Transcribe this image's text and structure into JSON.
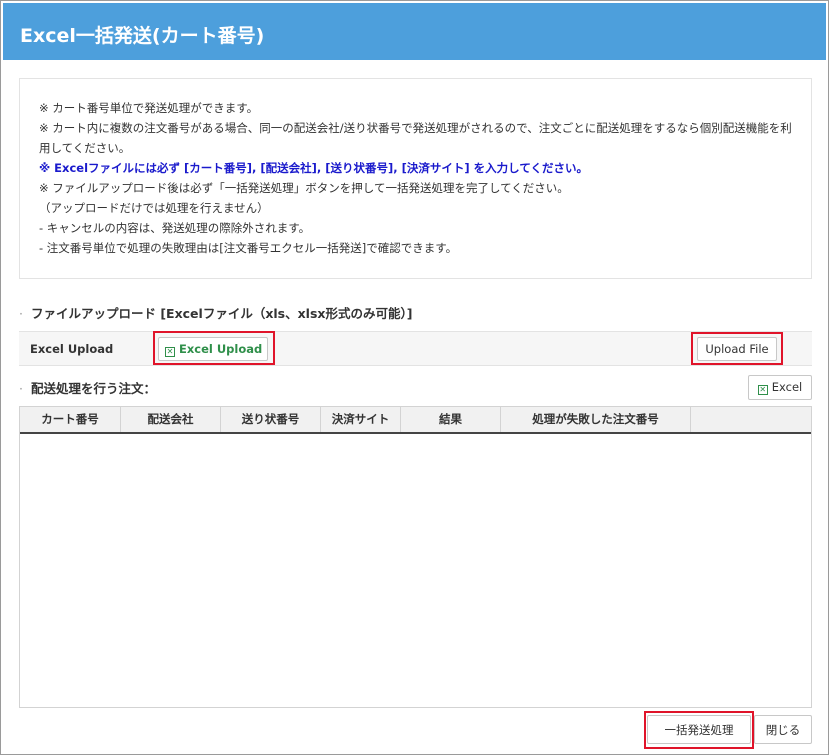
{
  "dialog": {
    "title": "Excel一括発送(カート番号)"
  },
  "notice": {
    "line1": "※ カート番号単位で発送処理ができます。",
    "line2": "※ カート内に複数の注文番号がある場合、同一の配送会社/送り状番号で発送処理がされるので、注文ごとに配送処理をするなら個別配送機能を利用してください。",
    "line3": "※ Excelファイルには必ず [カート番号], [配送会社], [送り状番号], [決済サイト] を入力してください。",
    "line4": "※ ファイルアップロード後は必ず「一括発送処理」ボタンを押して一括発送処理を完了してください。",
    "line5": "（アップロードだけでは処理を行えません）",
    "line6": "- キャンセルの内容は、発送処理の際除外されます。",
    "line7": "- 注文番号単位で処理の失敗理由は[注文番号エクセル一括発送]で確認できます。"
  },
  "upload": {
    "section_title": "ファイルアップロード [Excelファイル（xls、xlsx形式のみ可能）]",
    "row_label": "Excel Upload",
    "excel_button": "Excel Upload",
    "upload_button": "Upload File"
  },
  "results": {
    "section_title": "配送処理を行う注文：",
    "excel_button": "Excel",
    "columns": [
      "カート番号",
      "配送会社",
      "送り状番号",
      "決済サイト",
      "結果",
      "処理が失敗した注文番号"
    ]
  },
  "footer": {
    "bulk_button": "一括発送処理",
    "close_button": "閉じる"
  },
  "colors": {
    "titlebar": "#4d9fdc",
    "highlight_text": "#1a1acc",
    "excel_green": "#2f8f4a",
    "annotation_red": "#e0142a"
  },
  "icons": {
    "excel": "excel-file-icon"
  }
}
